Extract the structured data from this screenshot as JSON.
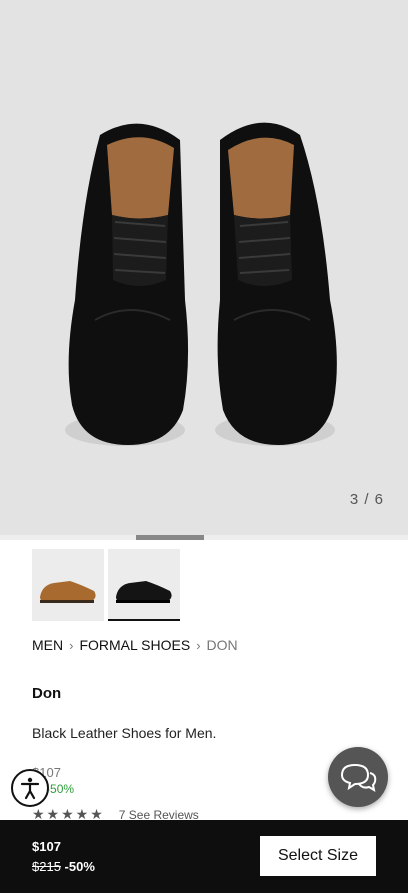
{
  "gallery": {
    "counter": "3 / 6"
  },
  "breadcrumb": {
    "items": [
      "MEN",
      "FORMAL SHOES",
      "DON"
    ]
  },
  "product": {
    "name": "Don",
    "description": "Black Leather Shoes for Men.",
    "price_current": "$107",
    "price_old_partial": "$",
    "discount": "-50%",
    "rating_stars": "★★★★★",
    "reviews_link": "7 See Reviews"
  },
  "bottom_bar": {
    "price": "$107",
    "price_old": "$215",
    "discount": "-50%",
    "select_size_label": "Select Size"
  },
  "colors": {
    "hero_bg": "#e3e3e3",
    "bottom_bar_bg": "#0e0e0e",
    "discount_green": "#2e9e3a"
  }
}
